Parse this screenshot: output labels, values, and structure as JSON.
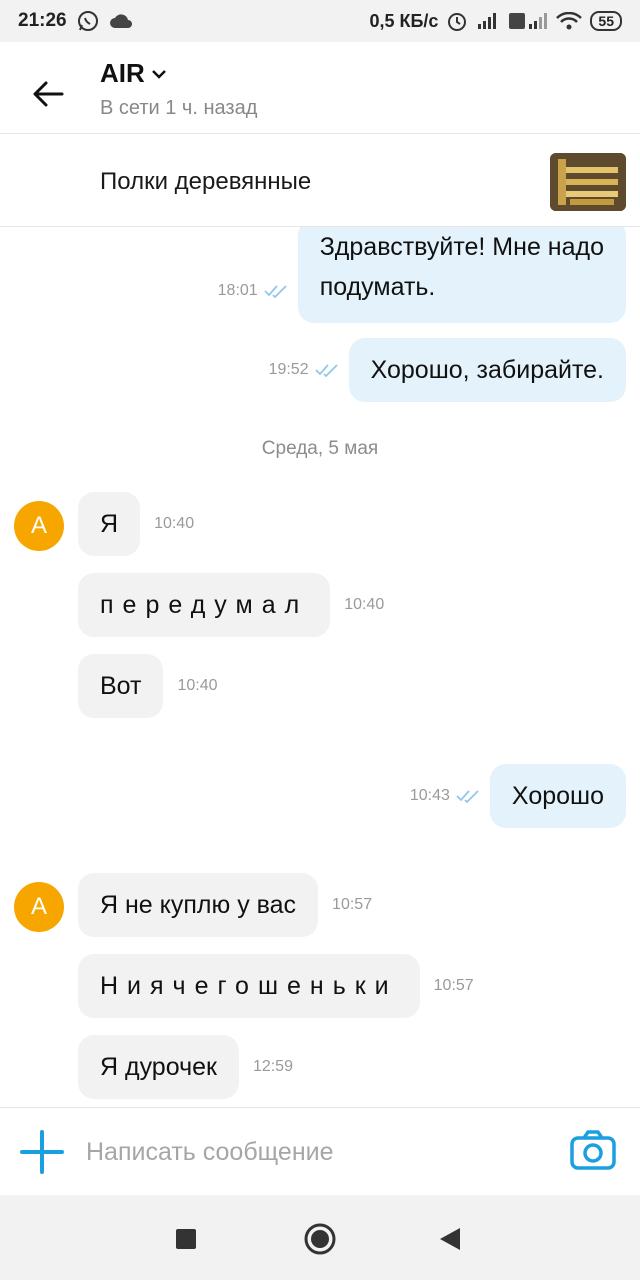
{
  "status_bar": {
    "time": "21:26",
    "speed": "0,5 КБ/с",
    "battery": "55",
    "icons": [
      "whatsapp-icon",
      "cloud-icon",
      "alarm-icon",
      "signal-icon",
      "volte-icon",
      "wifi-icon",
      "battery-icon"
    ]
  },
  "header": {
    "title": "AIR",
    "status": "В сети 1 ч. назад"
  },
  "product": {
    "name": "Полки деревянные"
  },
  "messages": [
    {
      "dir": "out",
      "text_line1": "Здравствуйте! Мне надо",
      "text_line2": "подумать.",
      "time": "18:01"
    },
    {
      "dir": "out",
      "text": "Хорошо, забирайте.",
      "time": "19:52"
    },
    {
      "type": "date",
      "text": "Среда, 5 мая"
    },
    {
      "dir": "in",
      "text": "Я",
      "time": "10:40"
    },
    {
      "dir": "in",
      "text": "передумал",
      "time": "10:40"
    },
    {
      "dir": "in",
      "text": "Вот",
      "time": "10:40"
    },
    {
      "dir": "out",
      "text": "Хорошо",
      "time": "10:43"
    },
    {
      "dir": "in",
      "text": "Я не куплю у вас",
      "time": "10:57"
    },
    {
      "dir": "in",
      "text": "Ниячегошеньки",
      "time": "10:57"
    },
    {
      "dir": "in",
      "text": "Я дурочек",
      "time": "12:59"
    }
  ],
  "avatar_letter": "А",
  "composer": {
    "placeholder": "Написать сообщение"
  },
  "colors": {
    "accent": "#1aa0e0",
    "out_bubble": "#e3f2fb",
    "in_bubble": "#f2f2f2",
    "avatar": "#f7a600"
  }
}
